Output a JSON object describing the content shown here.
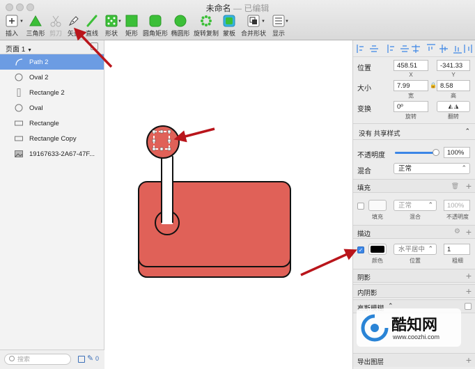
{
  "window": {
    "title": "未命名",
    "subtitle": " — 已编辑"
  },
  "toolbar": [
    {
      "name": "insert",
      "label": "插入",
      "icon": "plus-icon",
      "disabled": false,
      "caret": true
    },
    {
      "name": "triangle",
      "label": "三角形",
      "icon": "triangle-icon",
      "disabled": false
    },
    {
      "name": "cut",
      "label": "剪刀",
      "icon": "scissors-icon",
      "disabled": true
    },
    {
      "name": "vector",
      "label": "矢量",
      "icon": "pen-icon",
      "disabled": false
    },
    {
      "name": "line",
      "label": "直线",
      "icon": "line-icon",
      "disabled": false
    },
    {
      "name": "shape",
      "label": "形状",
      "icon": "dice-icon",
      "disabled": false,
      "caret": true
    },
    {
      "name": "rect",
      "label": "矩形",
      "icon": "rectangle-icon",
      "disabled": false
    },
    {
      "name": "rounded-rect",
      "label": "圆角矩形",
      "icon": "rounded-rect-icon",
      "disabled": false
    },
    {
      "name": "oval",
      "label": "椭圆形",
      "icon": "oval-icon",
      "disabled": false
    },
    {
      "name": "rotate-copy",
      "label": "旋转复制",
      "icon": "rotate-copy-icon",
      "disabled": false
    },
    {
      "name": "mask",
      "label": "蒙板",
      "icon": "mask-icon",
      "disabled": false
    },
    {
      "name": "combine",
      "label": "合并形状",
      "icon": "combine-icon",
      "disabled": false,
      "caret": true
    },
    {
      "name": "view",
      "label": "显示",
      "icon": "view-icon",
      "disabled": false,
      "caret": true
    }
  ],
  "sidebar": {
    "page": "页面 1",
    "layers": [
      {
        "label": "Path 2",
        "icon": "path-icon",
        "selected": true
      },
      {
        "label": "Oval 2",
        "icon": "oval-layer-icon",
        "selected": false
      },
      {
        "label": "Rectangle 2",
        "icon": "rect-vertical-icon",
        "selected": false
      },
      {
        "label": "Oval",
        "icon": "oval-layer-icon",
        "selected": false
      },
      {
        "label": "Rectangle",
        "icon": "rect-layer-icon",
        "selected": false
      },
      {
        "label": "Rectangle Copy",
        "icon": "rect-layer-icon",
        "selected": false
      },
      {
        "label": "19167633-2A67-47F...",
        "icon": "image-icon",
        "selected": false
      }
    ],
    "search_placeholder": "搜索",
    "footer_count": "0"
  },
  "inspector": {
    "position": {
      "label": "位置",
      "x": "458.51",
      "y": "-341.33",
      "x_label": "X",
      "y_label": "Y"
    },
    "size": {
      "label": "大小",
      "w": "7.99",
      "h": "8.58",
      "w_label": "宽",
      "h_label": "高"
    },
    "transform": {
      "label": "变换",
      "rotate": "0º",
      "rotate_label": "旋转",
      "flip_label": "翻转"
    },
    "shared_style": "没有 共享样式",
    "opacity": {
      "label": "不透明度",
      "value": "100%",
      "level": 1.0
    },
    "blend": {
      "label": "混合",
      "value": "正常"
    },
    "fill": {
      "title": "填充",
      "mode": "正常",
      "opacity": "100%",
      "c1": "填充",
      "c2": "混合",
      "c3": "不透明度"
    },
    "border": {
      "title": "描边",
      "color": "#000000",
      "position": "水平居中",
      "width": "1",
      "c1": "颜色",
      "c2": "位置",
      "c3": "粗细"
    },
    "shadow": "阴影",
    "inner_shadow": "内阴影",
    "blur": "高斯模糊",
    "export": "导出图层"
  },
  "watermark": {
    "brand": "酷知网",
    "url": "www.coozhi.com"
  },
  "colors": {
    "accent": "#6c9ce3",
    "shape_fill": "#e06158",
    "toolbar_green": "#3cbf38",
    "arrow": "#b9151b"
  }
}
